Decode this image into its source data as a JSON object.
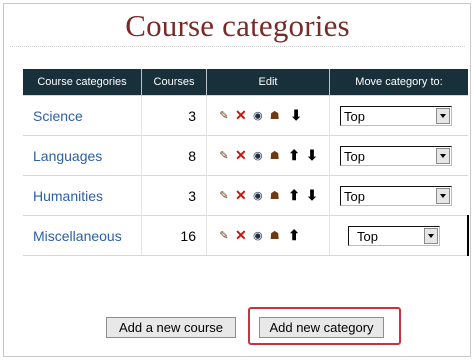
{
  "page": {
    "title": "Course categories"
  },
  "table": {
    "headers": [
      "Course categories",
      "Courses",
      "Edit",
      "Move category to:"
    ],
    "rows": [
      {
        "name": "Science",
        "courses": "3",
        "move_to": "Top"
      },
      {
        "name": "Languages",
        "courses": "8",
        "move_to": "Top"
      },
      {
        "name": "Humanities",
        "courses": "3",
        "move_to": "Top"
      },
      {
        "name": "Miscellaneous",
        "courses": "16",
        "move_to": "Top"
      }
    ]
  },
  "icons": {
    "edit": "✎",
    "delete": "✕",
    "hide": "◉",
    "roles": "☗",
    "up": "⬆",
    "down": "⬇"
  },
  "buttons": {
    "add_course": "Add a new course",
    "add_category": "Add new category"
  },
  "colors": {
    "title": "#7a2a27",
    "header_bg": "#17303a",
    "link": "#2e60a4",
    "highlight": "#c8333d"
  }
}
